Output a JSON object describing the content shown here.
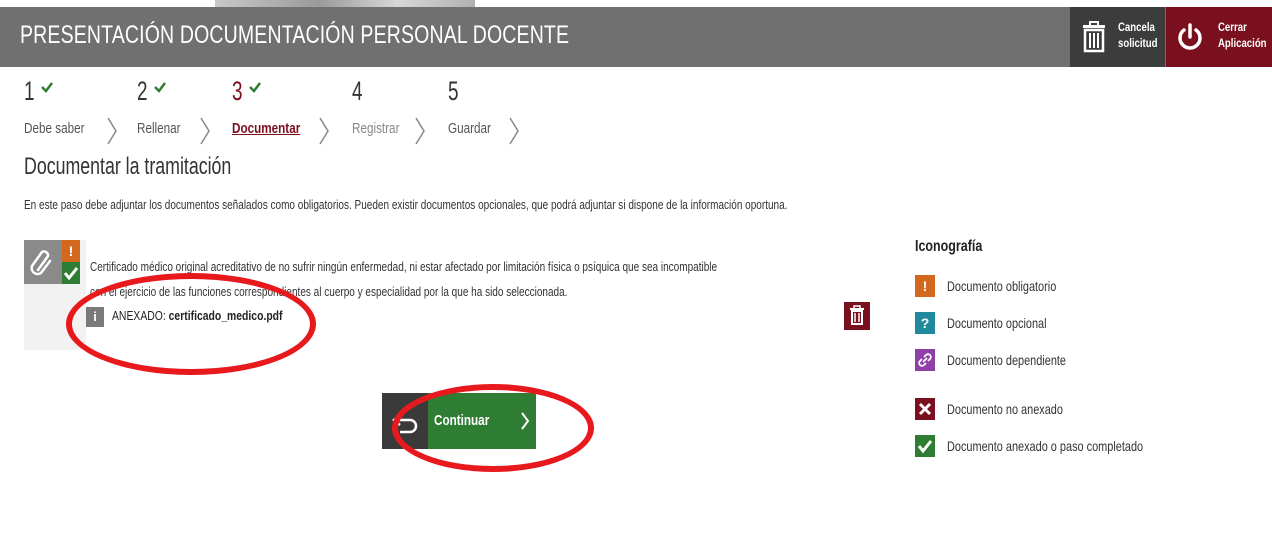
{
  "header": {
    "title": "PRESENTACIÓN DOCUMENTACIÓN PERSONAL DOCENTE",
    "cancel_line1": "Cancela",
    "cancel_line2": "solicitud",
    "close_line1": "Cerrar",
    "close_line2": "Aplicación"
  },
  "steps": [
    {
      "number": "1",
      "label": "Debe saber",
      "completed": true
    },
    {
      "number": "2",
      "label": "Rellenar",
      "completed": true
    },
    {
      "number": "3",
      "label": "Documentar",
      "completed": true,
      "active": true
    },
    {
      "number": "4",
      "label": "Registrar",
      "completed": false
    },
    {
      "number": "5",
      "label": "Guardar",
      "completed": false
    }
  ],
  "section": {
    "title": "Documentar la tramitación",
    "intro": "En este paso debe adjuntar los documentos señalados como obligatorios. Pueden existir documentos opcionales, que podrá adjuntar si dispone de la información oportuna."
  },
  "document": {
    "description_line1": "Certificado médico original acreditativo de no sufrir ningún enfermedad, ni estar afectado por limitación física o psíquica que sea incompatible",
    "description_line2": "con el ejercicio de las funciones correspondientes al cuerpo y especialidad por la que ha sido seleccionada.",
    "annex_prefix": "ANEXADO:",
    "annex_file": "certificado_medico.pdf",
    "info_glyph": "i",
    "required_glyph": "!"
  },
  "actions": {
    "continue_label": "Continuar"
  },
  "legend": {
    "title": "Iconografía",
    "items": [
      {
        "icon": "exclamation-icon",
        "glyph": "!",
        "color": "#d2691e",
        "label": "Documento obligatorio"
      },
      {
        "icon": "question-icon",
        "glyph": "?",
        "color": "#1f8a9e",
        "label": "Documento opcional"
      },
      {
        "icon": "link-icon",
        "glyph": "",
        "color": "#8e3fa8",
        "label": "Documento dependiente"
      },
      {
        "icon": "cross-icon",
        "glyph": "",
        "color": "#7a0f1e",
        "label": "Documento no anexado"
      },
      {
        "icon": "check-icon",
        "glyph": "",
        "color": "#2e7d32",
        "label": "Documento anexado o paso completado"
      }
    ]
  },
  "colors": {
    "header_bg": "#707070",
    "accent": "#7a0f1e",
    "success": "#2e7d32",
    "annotation": "#e8191d"
  }
}
